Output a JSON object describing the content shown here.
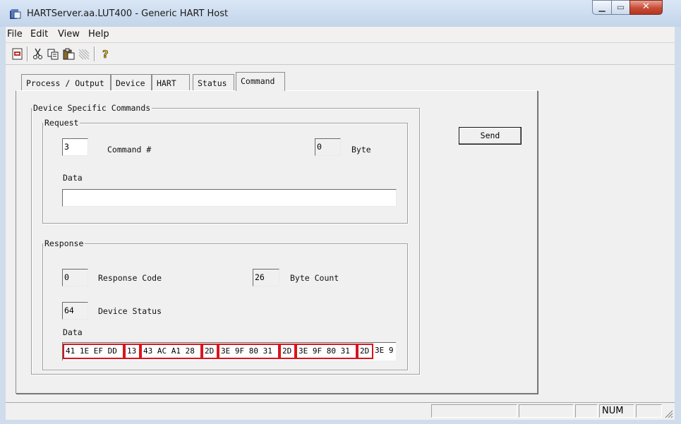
{
  "window": {
    "title": "HARTServer.aa.LUT400 - Generic HART Host"
  },
  "menu": [
    "File",
    "Edit",
    "View",
    "Help"
  ],
  "toolbar_icons": [
    "new-icon",
    "cut-icon",
    "copy-icon",
    "paste-icon",
    "grid-icon",
    "help-icon"
  ],
  "tabs": [
    {
      "label": "Process / Output"
    },
    {
      "label": "Device"
    },
    {
      "label": "HART"
    },
    {
      "label": "Status"
    },
    {
      "label": "Command",
      "active": true
    }
  ],
  "group_device": {
    "label": "Device Specific Commands"
  },
  "request": {
    "label": "Request",
    "command_value": "3",
    "command_label": "Command #",
    "byte_value": "0",
    "byte_label": "Byte",
    "data_label": "Data",
    "data_value": ""
  },
  "send_label": "Send",
  "response": {
    "label": "Response",
    "code_value": "0",
    "code_label": "Response Code",
    "count_value": "26",
    "count_label": "Byte Count",
    "status_value": "64",
    "status_label": "Device Status",
    "data_label": "Data",
    "bytes": [
      {
        "text": "41 1E EF DD",
        "hl": true
      },
      {
        "text": "13",
        "hl": true
      },
      {
        "text": "43 AC A1 28",
        "hl": true
      },
      {
        "text": "2D",
        "hl": true
      },
      {
        "text": "3E 9F 80 31",
        "hl": true
      },
      {
        "text": "2D",
        "hl": true
      },
      {
        "text": "3E 9F 80 31",
        "hl": true
      },
      {
        "text": "2D",
        "hl": true
      },
      {
        "text": "3E 9",
        "hl": false
      }
    ]
  },
  "statusbar": {
    "num": "NUM"
  },
  "colors": {
    "highlight": "#d9141c",
    "title_gradient_top": "#d9e6f5"
  }
}
